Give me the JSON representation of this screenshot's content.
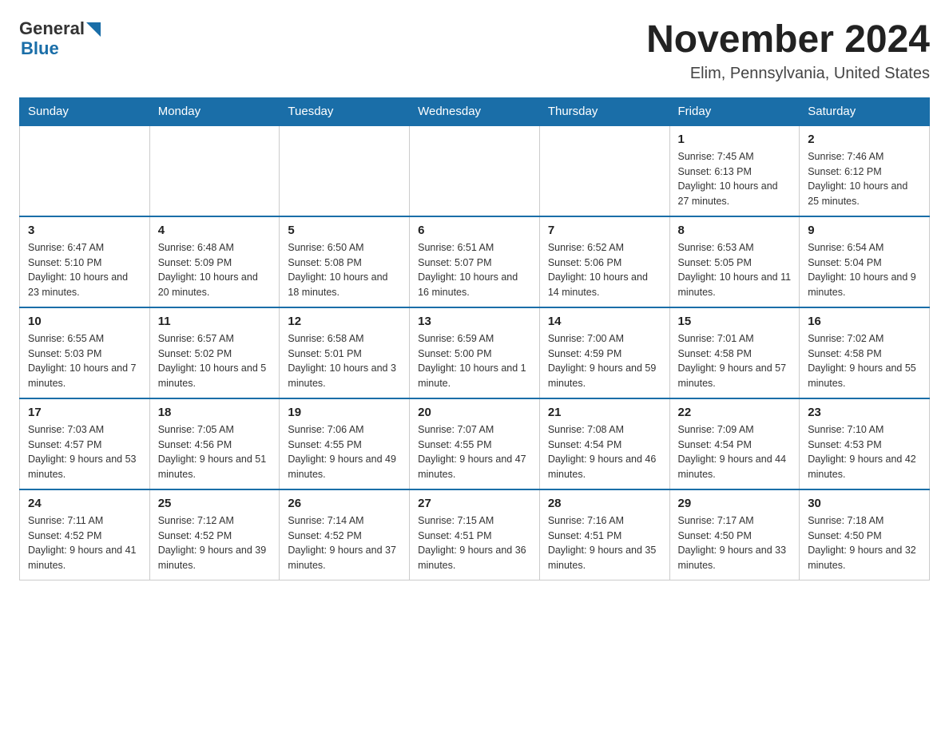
{
  "header": {
    "logo_general": "General",
    "logo_blue": "Blue",
    "month_year": "November 2024",
    "location": "Elim, Pennsylvania, United States"
  },
  "days_of_week": [
    "Sunday",
    "Monday",
    "Tuesday",
    "Wednesday",
    "Thursday",
    "Friday",
    "Saturday"
  ],
  "weeks": [
    [
      {
        "day": "",
        "info": ""
      },
      {
        "day": "",
        "info": ""
      },
      {
        "day": "",
        "info": ""
      },
      {
        "day": "",
        "info": ""
      },
      {
        "day": "",
        "info": ""
      },
      {
        "day": "1",
        "info": "Sunrise: 7:45 AM\nSunset: 6:13 PM\nDaylight: 10 hours and 27 minutes."
      },
      {
        "day": "2",
        "info": "Sunrise: 7:46 AM\nSunset: 6:12 PM\nDaylight: 10 hours and 25 minutes."
      }
    ],
    [
      {
        "day": "3",
        "info": "Sunrise: 6:47 AM\nSunset: 5:10 PM\nDaylight: 10 hours and 23 minutes."
      },
      {
        "day": "4",
        "info": "Sunrise: 6:48 AM\nSunset: 5:09 PM\nDaylight: 10 hours and 20 minutes."
      },
      {
        "day": "5",
        "info": "Sunrise: 6:50 AM\nSunset: 5:08 PM\nDaylight: 10 hours and 18 minutes."
      },
      {
        "day": "6",
        "info": "Sunrise: 6:51 AM\nSunset: 5:07 PM\nDaylight: 10 hours and 16 minutes."
      },
      {
        "day": "7",
        "info": "Sunrise: 6:52 AM\nSunset: 5:06 PM\nDaylight: 10 hours and 14 minutes."
      },
      {
        "day": "8",
        "info": "Sunrise: 6:53 AM\nSunset: 5:05 PM\nDaylight: 10 hours and 11 minutes."
      },
      {
        "day": "9",
        "info": "Sunrise: 6:54 AM\nSunset: 5:04 PM\nDaylight: 10 hours and 9 minutes."
      }
    ],
    [
      {
        "day": "10",
        "info": "Sunrise: 6:55 AM\nSunset: 5:03 PM\nDaylight: 10 hours and 7 minutes."
      },
      {
        "day": "11",
        "info": "Sunrise: 6:57 AM\nSunset: 5:02 PM\nDaylight: 10 hours and 5 minutes."
      },
      {
        "day": "12",
        "info": "Sunrise: 6:58 AM\nSunset: 5:01 PM\nDaylight: 10 hours and 3 minutes."
      },
      {
        "day": "13",
        "info": "Sunrise: 6:59 AM\nSunset: 5:00 PM\nDaylight: 10 hours and 1 minute."
      },
      {
        "day": "14",
        "info": "Sunrise: 7:00 AM\nSunset: 4:59 PM\nDaylight: 9 hours and 59 minutes."
      },
      {
        "day": "15",
        "info": "Sunrise: 7:01 AM\nSunset: 4:58 PM\nDaylight: 9 hours and 57 minutes."
      },
      {
        "day": "16",
        "info": "Sunrise: 7:02 AM\nSunset: 4:58 PM\nDaylight: 9 hours and 55 minutes."
      }
    ],
    [
      {
        "day": "17",
        "info": "Sunrise: 7:03 AM\nSunset: 4:57 PM\nDaylight: 9 hours and 53 minutes."
      },
      {
        "day": "18",
        "info": "Sunrise: 7:05 AM\nSunset: 4:56 PM\nDaylight: 9 hours and 51 minutes."
      },
      {
        "day": "19",
        "info": "Sunrise: 7:06 AM\nSunset: 4:55 PM\nDaylight: 9 hours and 49 minutes."
      },
      {
        "day": "20",
        "info": "Sunrise: 7:07 AM\nSunset: 4:55 PM\nDaylight: 9 hours and 47 minutes."
      },
      {
        "day": "21",
        "info": "Sunrise: 7:08 AM\nSunset: 4:54 PM\nDaylight: 9 hours and 46 minutes."
      },
      {
        "day": "22",
        "info": "Sunrise: 7:09 AM\nSunset: 4:54 PM\nDaylight: 9 hours and 44 minutes."
      },
      {
        "day": "23",
        "info": "Sunrise: 7:10 AM\nSunset: 4:53 PM\nDaylight: 9 hours and 42 minutes."
      }
    ],
    [
      {
        "day": "24",
        "info": "Sunrise: 7:11 AM\nSunset: 4:52 PM\nDaylight: 9 hours and 41 minutes."
      },
      {
        "day": "25",
        "info": "Sunrise: 7:12 AM\nSunset: 4:52 PM\nDaylight: 9 hours and 39 minutes."
      },
      {
        "day": "26",
        "info": "Sunrise: 7:14 AM\nSunset: 4:52 PM\nDaylight: 9 hours and 37 minutes."
      },
      {
        "day": "27",
        "info": "Sunrise: 7:15 AM\nSunset: 4:51 PM\nDaylight: 9 hours and 36 minutes."
      },
      {
        "day": "28",
        "info": "Sunrise: 7:16 AM\nSunset: 4:51 PM\nDaylight: 9 hours and 35 minutes."
      },
      {
        "day": "29",
        "info": "Sunrise: 7:17 AM\nSunset: 4:50 PM\nDaylight: 9 hours and 33 minutes."
      },
      {
        "day": "30",
        "info": "Sunrise: 7:18 AM\nSunset: 4:50 PM\nDaylight: 9 hours and 32 minutes."
      }
    ]
  ]
}
